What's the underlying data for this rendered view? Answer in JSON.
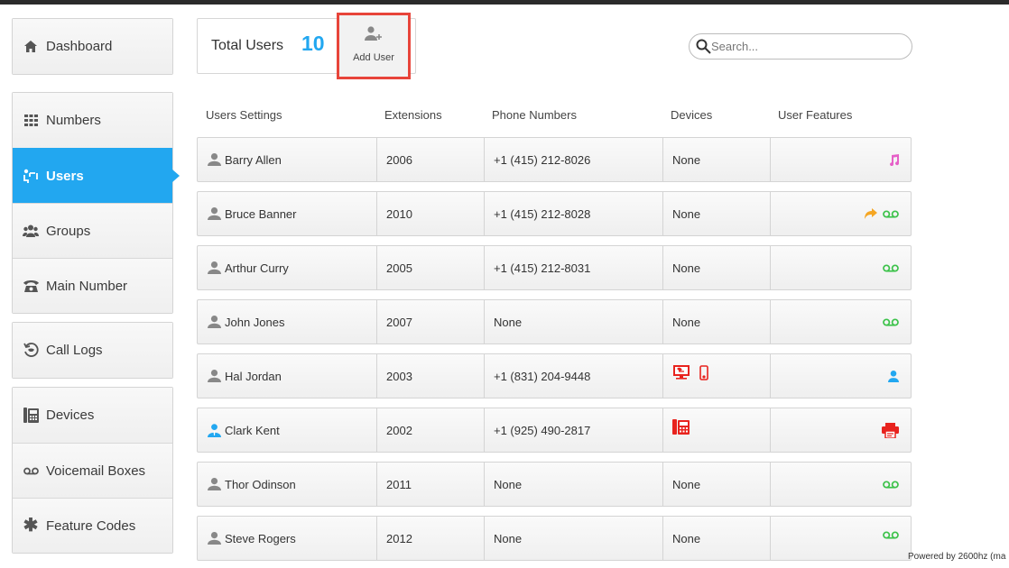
{
  "sidebar": {
    "dashboard": {
      "label": "Dashboard",
      "icon": "home-icon"
    },
    "numbers": {
      "label": "Numbers",
      "icon": "grid-icon"
    },
    "users": {
      "label": "Users",
      "icon": "users-icon",
      "active": true
    },
    "groups": {
      "label": "Groups",
      "icon": "group-icon"
    },
    "main_number": {
      "label": "Main Number",
      "icon": "phone-icon"
    },
    "call_logs": {
      "label": "Call Logs",
      "icon": "call-log-icon"
    },
    "devices": {
      "label": "Devices",
      "icon": "desk-phone-icon"
    },
    "voicemail": {
      "label": "Voicemail Boxes",
      "icon": "voicemail-icon"
    },
    "feature_codes": {
      "label": "Feature Codes",
      "icon": "asterisk-icon"
    }
  },
  "header": {
    "total_label": "Total Users",
    "total_count": "10",
    "add_user_label": "Add User"
  },
  "search": {
    "placeholder": "Search...",
    "value": ""
  },
  "table": {
    "columns": [
      "Users Settings",
      "Extensions",
      "Phone Numbers",
      "Devices",
      "User Features"
    ],
    "rows": [
      {
        "name": "Barry Allen",
        "extension": "2006",
        "phone": "+1 (415) 212-8026",
        "devices": "None",
        "features": [
          "music-icon"
        ]
      },
      {
        "name": "Bruce Banner",
        "extension": "2010",
        "phone": "+1 (415) 212-8028",
        "devices": "None",
        "features": [
          "call-forward-icon",
          "voicemail-icon"
        ]
      },
      {
        "name": "Arthur Curry",
        "extension": "2005",
        "phone": "+1 (415) 212-8031",
        "devices": "None",
        "features": [
          "voicemail-icon"
        ]
      },
      {
        "name": "John Jones",
        "extension": "2007",
        "phone": "None",
        "devices": "None",
        "features": [
          "voicemail-icon"
        ]
      },
      {
        "name": "Hal Jordan",
        "extension": "2003",
        "phone": "+1 (831) 204-9448",
        "devices": "",
        "device_icons": [
          "softphone-icon",
          "cellphone-icon"
        ],
        "features": [
          "user-icon"
        ]
      },
      {
        "name": "Clark Kent",
        "extension": "2002",
        "phone": "+1 (925) 490-2817",
        "devices": "",
        "device_icons": [
          "desk-phone-icon"
        ],
        "features": [
          "fax-icon"
        ],
        "admin": true
      },
      {
        "name": "Thor Odinson",
        "extension": "2011",
        "phone": "None",
        "devices": "None",
        "features": [
          "voicemail-icon"
        ]
      },
      {
        "name": "Steve Rogers",
        "extension": "2012",
        "phone": "None",
        "devices": "None",
        "features": [
          "voicemail-icon"
        ]
      }
    ]
  },
  "footer": {
    "text": "Powered by 2600hz  (ma"
  },
  "colors": {
    "accent": "#22a7f0",
    "device_red": "#e8231e",
    "voicemail_green": "#3cc24a",
    "forward_orange": "#f5a623",
    "music_pink": "#e660c8",
    "highlight": "#e8443a"
  }
}
